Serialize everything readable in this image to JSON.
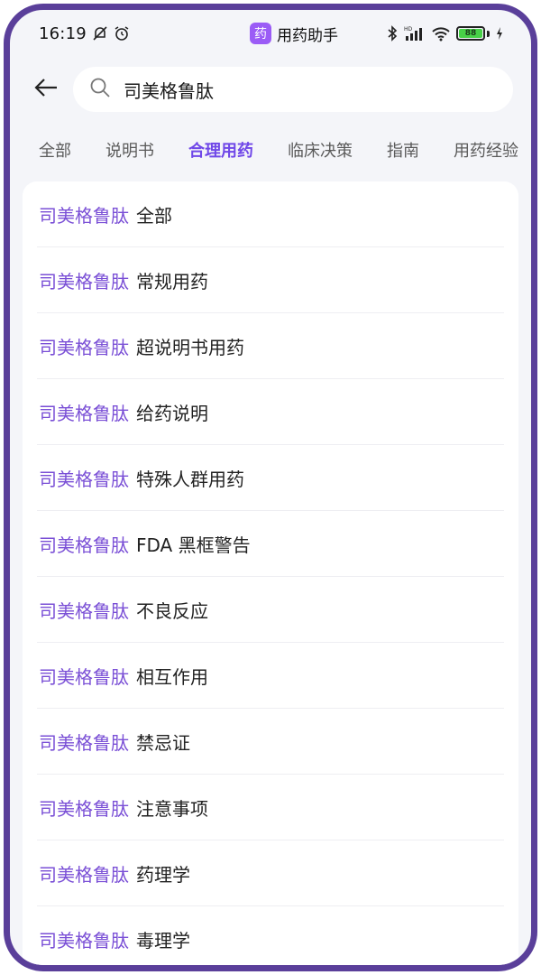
{
  "status_bar": {
    "time": "16:19",
    "app_name": "用药助手",
    "app_badge_char": "药",
    "battery_level": "88",
    "icons": [
      "bell-off-icon",
      "alarm-icon",
      "bluetooth-icon",
      "hd-signal-icon",
      "wifi-icon",
      "battery-icon",
      "charging-icon"
    ]
  },
  "search": {
    "query": "司美格鲁肽",
    "back_icon": "arrow-left-icon",
    "search_icon": "search-icon"
  },
  "tabs": {
    "items": [
      "全部",
      "说明书",
      "合理用药",
      "临床决策",
      "指南",
      "用药经验"
    ],
    "active_index": 2
  },
  "accent_color": "#7a4fd6",
  "results": {
    "keyword": "司美格鲁肽",
    "items": [
      "全部",
      "常规用药",
      "超说明书用药",
      "给药说明",
      "特殊人群用药",
      "FDA 黑框警告",
      "不良反应",
      "相互作用",
      "禁忌证",
      "注意事项",
      "药理学",
      "毒理学"
    ]
  }
}
